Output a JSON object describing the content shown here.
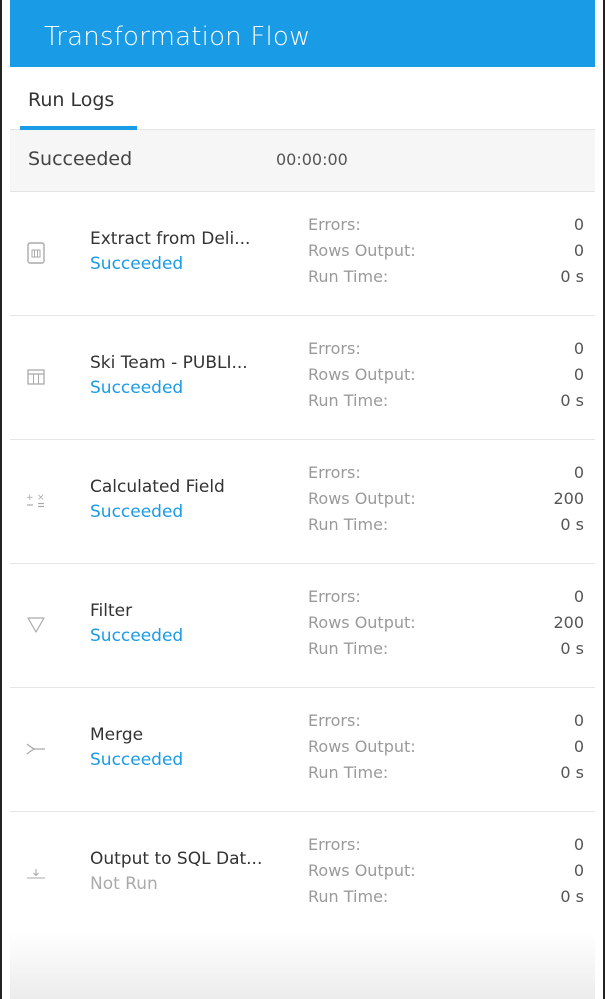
{
  "window": {
    "title": "Transformation Flow"
  },
  "tabs": [
    {
      "label": "Run Logs",
      "active": true
    }
  ],
  "summary": {
    "status": "Succeeded",
    "duration": "00:00:00"
  },
  "stat_labels": {
    "errors": "Errors:",
    "rows_output": "Rows Output:",
    "run_time": "Run Time:"
  },
  "steps": [
    {
      "icon": "delimited-file-icon",
      "name": "Extract from Deli...",
      "status": "Succeeded",
      "errors": "0",
      "rows_output": "0",
      "run_time": "0 s"
    },
    {
      "icon": "table-icon",
      "name": "Ski Team - PUBLI...",
      "status": "Succeeded",
      "errors": "0",
      "rows_output": "0",
      "run_time": "0 s"
    },
    {
      "icon": "calculator-icon",
      "name": "Calculated Field",
      "status": "Succeeded",
      "errors": "0",
      "rows_output": "200",
      "run_time": "0 s"
    },
    {
      "icon": "filter-icon",
      "name": "Filter",
      "status": "Succeeded",
      "errors": "0",
      "rows_output": "200",
      "run_time": "0 s"
    },
    {
      "icon": "merge-icon",
      "name": "Merge",
      "status": "Succeeded",
      "errors": "0",
      "rows_output": "0",
      "run_time": "0 s"
    },
    {
      "icon": "output-icon",
      "name": "Output to SQL Dat...",
      "status": "Not Run",
      "errors": "0",
      "rows_output": "0",
      "run_time": "0 s"
    }
  ],
  "colors": {
    "accent": "#1a9be6",
    "not_run": "#aaaaaa"
  }
}
